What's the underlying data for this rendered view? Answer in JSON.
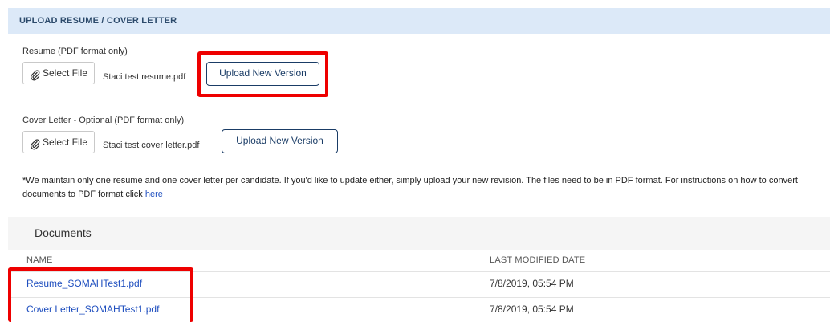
{
  "header": {
    "title": "UPLOAD RESUME / COVER LETTER"
  },
  "resume": {
    "label": "Resume (PDF format only)",
    "select_label": "Select File",
    "filename": "Staci test resume.pdf",
    "upload_label": "Upload New Version"
  },
  "cover_letter": {
    "label": "Cover Letter - Optional (PDF format only)",
    "select_label": "Select File",
    "filename": "Staci test cover letter.pdf",
    "upload_label": "Upload New Version"
  },
  "note": {
    "text": "*We maintain only one resume and one cover letter per candidate. If you'd like to update either, simply upload your new revision. The files need to be in PDF format. For instructions on how to convert documents to PDF format click ",
    "link": "here"
  },
  "documents": {
    "title": "Documents",
    "columns": [
      "NAME",
      "LAST MODIFIED DATE"
    ],
    "rows": [
      {
        "name": "Resume_SOMAHTest1.pdf",
        "date": "7/8/2019, 05:54 PM"
      },
      {
        "name": "Cover Letter_SOMAHTest1.pdf",
        "date": "7/8/2019, 05:54 PM"
      }
    ]
  },
  "colors": {
    "highlight": "#ee0000",
    "link": "#1f4fbf",
    "header_bg": "#dce9f8",
    "button_border": "#1a3c66"
  },
  "icons": {
    "attach": "paperclip-icon"
  }
}
